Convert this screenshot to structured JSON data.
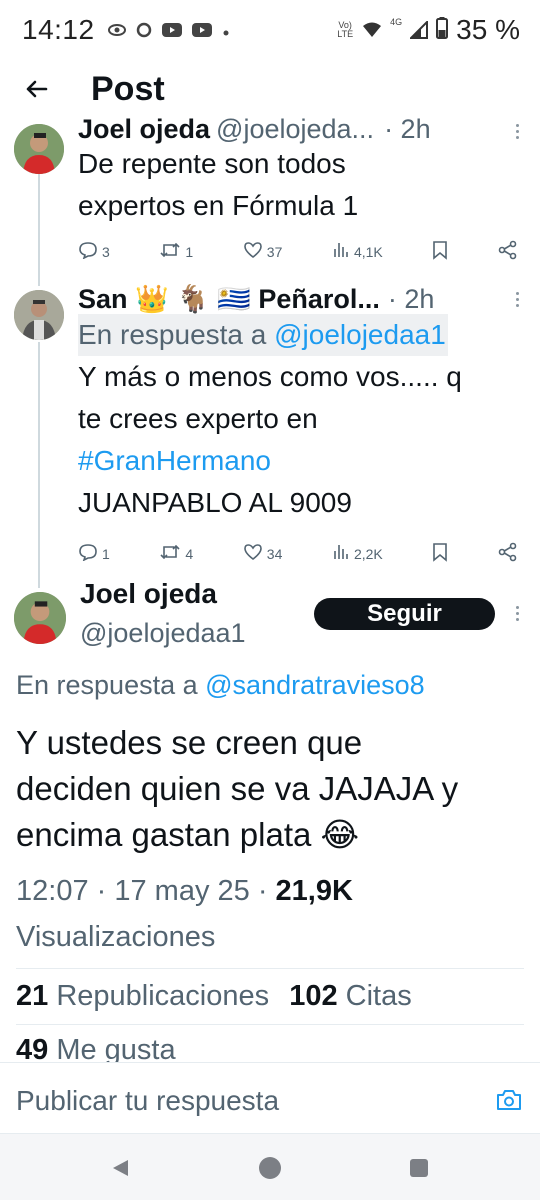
{
  "status_bar": {
    "time": "14:12",
    "battery": "35 %",
    "network_label_1": "Vo)\nLTE",
    "network_label_2": "4G",
    "left_icons": [
      "eye-icon",
      "circle-icon",
      "youtube-icon",
      "youtube-icon",
      "dot-icon"
    ],
    "right_icons": [
      "wifi-icon",
      "signal-icon",
      "battery-icon"
    ]
  },
  "header": {
    "title": "Post"
  },
  "thread": [
    {
      "name": "Joel ojeda",
      "handle": "@joelojeda...",
      "time": "· 2h",
      "text_lines": [
        "De repente son todos",
        "expertos en Fórmula 1"
      ],
      "stats": {
        "replies": "3",
        "reposts": "1",
        "likes": "37",
        "views": "4,1K"
      }
    },
    {
      "name": "San 👑 🐐 🇺🇾 Peñarol...",
      "time": "· 2h",
      "reply_prefix": "En respuesta a ",
      "reply_handle": "@joelojedaa1",
      "text_line_1": "Y más o menos como vos..... q",
      "text_line_2": "te crees experto en",
      "hashtag": "#GranHermano",
      "text_line_4": "JUANPABLO AL 9009",
      "stats": {
        "replies": "1",
        "reposts": "4",
        "likes": "34",
        "views": "2,2K"
      }
    }
  ],
  "main_post": {
    "name": "Joel ojeda",
    "handle": "@joelojedaa1",
    "follow_label": "Seguir",
    "reply_prefix": "En respuesta a ",
    "reply_handle": "@sandratravieso8",
    "text_line_1": "Y ustedes se creen que",
    "text_line_2": "deciden quien se va JAJAJA y",
    "text_line_3": "encima gastan plata 😂",
    "timestamp": "12:07 · 17 may 25 · ",
    "views_count": "21,9K",
    "views_label": "Visualizaciones",
    "reposts_count": "21",
    "reposts_label": "Republicaciones",
    "quotes_count": "102",
    "quotes_label": "Citas",
    "likes_count": "49",
    "likes_label": "Me gusta"
  },
  "reply_bar": {
    "placeholder": "Publicar tu respuesta"
  },
  "colors": {
    "link": "#1d9bf0",
    "text": "#0f1419",
    "muted": "#536471",
    "button_bg": "#0f1419"
  }
}
